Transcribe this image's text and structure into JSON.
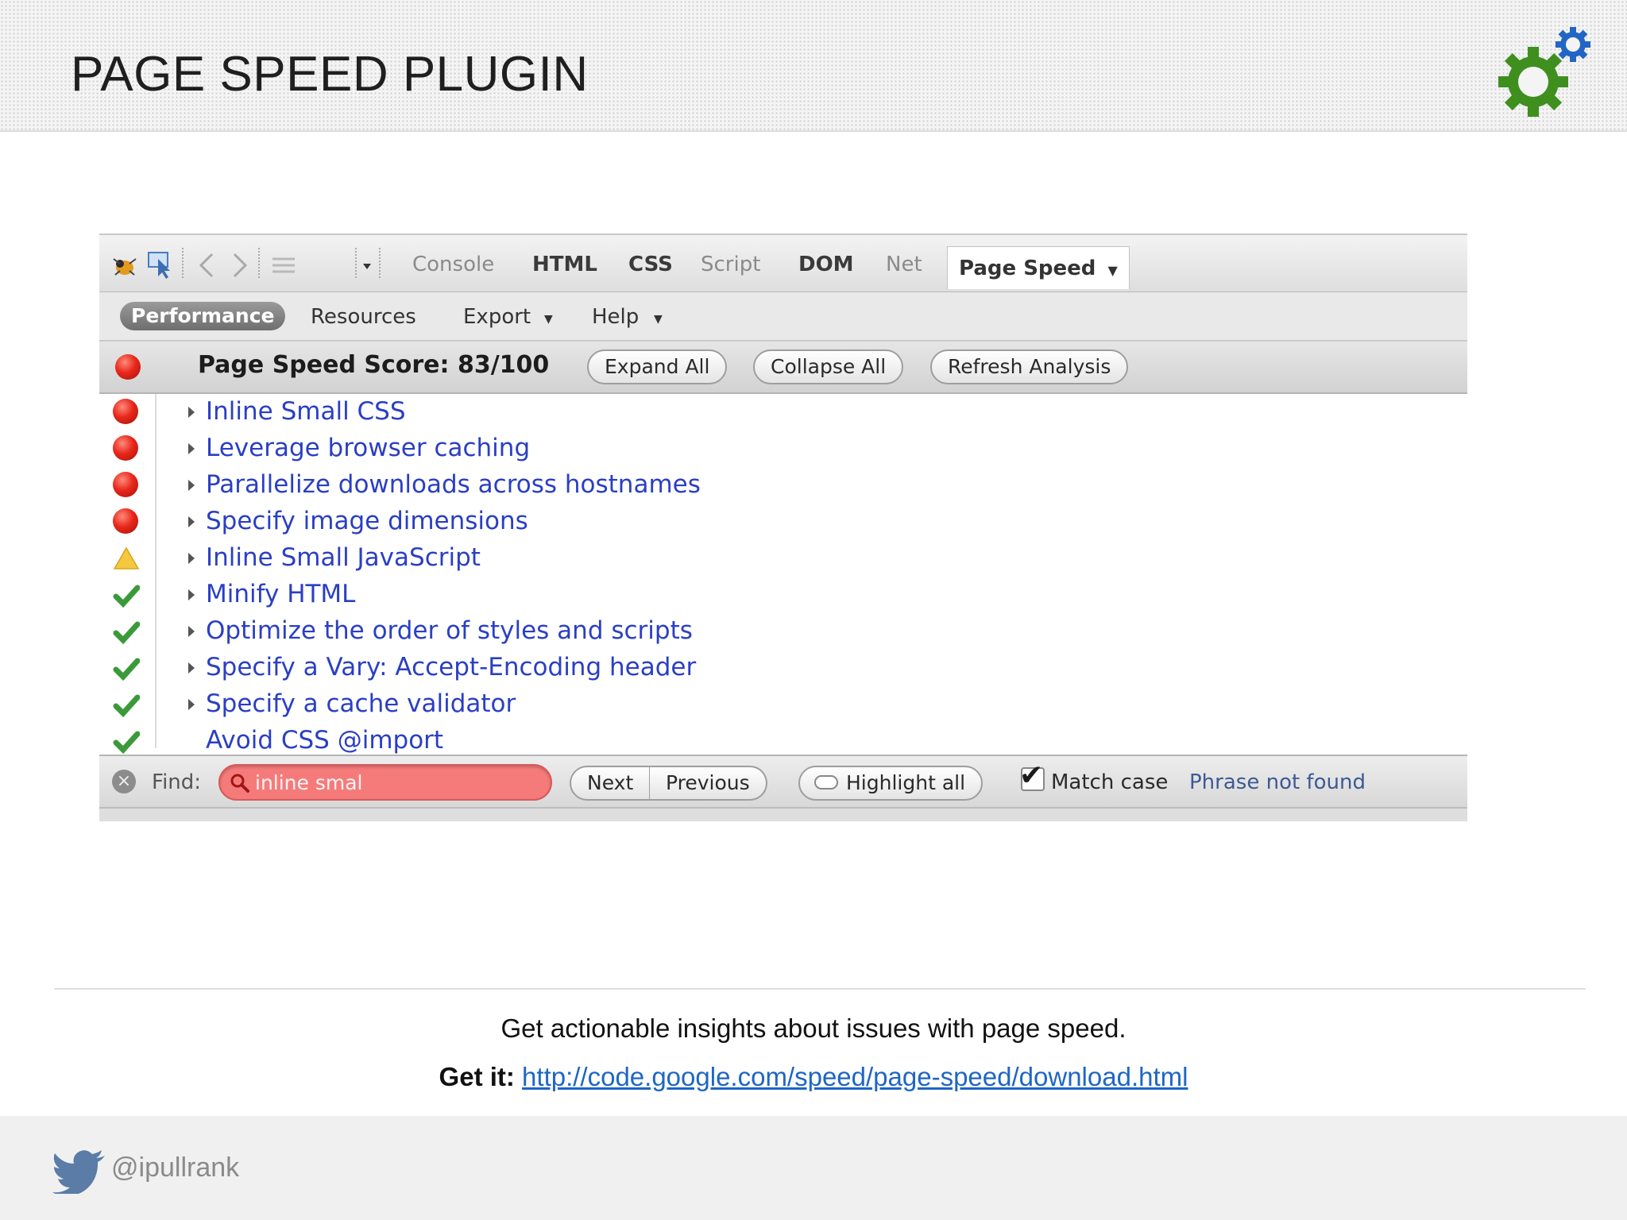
{
  "slide": {
    "title": "PAGE SPEED PLUGIN",
    "caption": "Get actionable insights about issues with page speed.",
    "get_it_label": "Get it:",
    "get_it_link": "http://code.google.com/speed/page-speed/download.html",
    "twitter_handle": "@ipullrank",
    "accent_colors": {
      "gear_green": "#3f8f1f",
      "gear_blue": "#2166c4",
      "link_blue": "#1e66c4"
    }
  },
  "firebug": {
    "tabs": [
      "Console",
      "HTML",
      "CSS",
      "Script",
      "DOM",
      "Net"
    ],
    "active_tab": "Page Speed",
    "subtabs": {
      "active": "Performance",
      "resources": "Resources",
      "export": "Export",
      "help": "Help"
    },
    "score_text": "Page Speed Score: 83/100",
    "buttons": {
      "expand_all": "Expand All",
      "collapse_all": "Collapse All",
      "refresh": "Refresh Analysis"
    },
    "rules": [
      {
        "label": "Inline Small CSS",
        "status": "red"
      },
      {
        "label": "Leverage browser caching",
        "status": "red"
      },
      {
        "label": "Parallelize downloads across hostnames",
        "status": "red"
      },
      {
        "label": "Specify image dimensions",
        "status": "red"
      },
      {
        "label": "Inline Small JavaScript",
        "status": "warning"
      },
      {
        "label": "Minify HTML",
        "status": "pass"
      },
      {
        "label": "Optimize the order of styles and scripts",
        "status": "pass"
      },
      {
        "label": "Specify a Vary: Accept-Encoding header",
        "status": "pass"
      },
      {
        "label": "Specify a cache validator",
        "status": "pass"
      },
      {
        "label": "Avoid CSS @import",
        "status": "pass"
      }
    ],
    "find_bar": {
      "label": "Find:",
      "value": "inline smal",
      "next": "Next",
      "previous": "Previous",
      "highlight_all": "Highlight all",
      "match_case": "Match case",
      "match_case_checked": true,
      "status": "Phrase not found"
    }
  }
}
